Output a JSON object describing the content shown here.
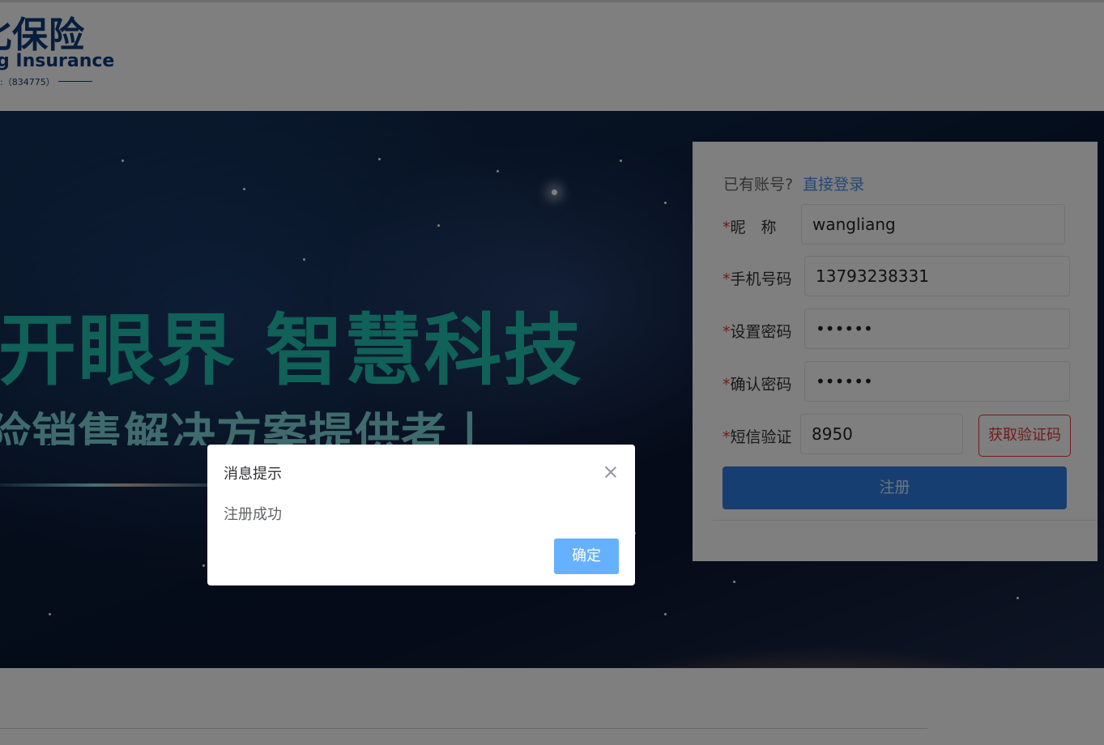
{
  "header": {
    "logo_cn": "北保险",
    "logo_en": "g Insurance",
    "logo_code": ":（834775）"
  },
  "banner": {
    "slogan_main": "开眼界 智慧科技",
    "slogan_sub": "险销售解决方案提供者丨"
  },
  "register": {
    "have_account": "已有账号?",
    "login_link": "直接登录",
    "required_mark": "*",
    "fields": [
      {
        "label": "昵　称",
        "value": "wangliang"
      },
      {
        "label": "手机号码",
        "value": "13793238331"
      },
      {
        "label": "设置密码",
        "value": "••••••"
      },
      {
        "label": "确认密码",
        "value": "••••••"
      },
      {
        "label": "短信验证",
        "value": "8950"
      }
    ],
    "sms_button": "获取验证码",
    "submit_button": "注册"
  },
  "dialog": {
    "title": "消息提示",
    "message": "注册成功",
    "confirm": "确定"
  },
  "colors": {
    "accent": "#2f7de1",
    "required": "#e53935",
    "dialog_button": "#66b1ff",
    "slogan": "#21c2b0"
  }
}
